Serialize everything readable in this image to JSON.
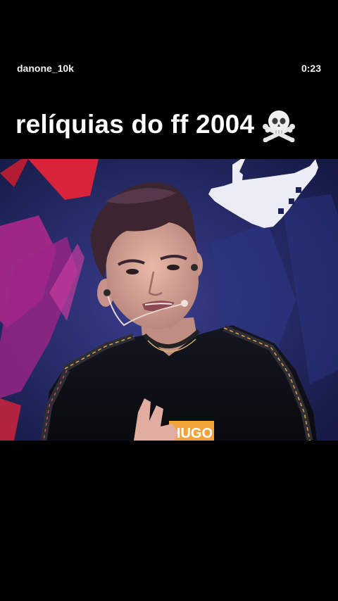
{
  "header": {
    "username": "danone_10k",
    "timestamp": "0:23"
  },
  "caption": {
    "text": "relíquias do ff 2004",
    "emoji_icon": "skull-and-crossbones-icon"
  },
  "video": {
    "shirt_print": "HUGO"
  },
  "colors": {
    "background": "#000000",
    "text": "#ffffff",
    "stage_blue": "#232a63",
    "stage_red": "#d8243a",
    "stage_magenta": "#b4288c",
    "shirt_logo_orange": "#f2a33a"
  }
}
